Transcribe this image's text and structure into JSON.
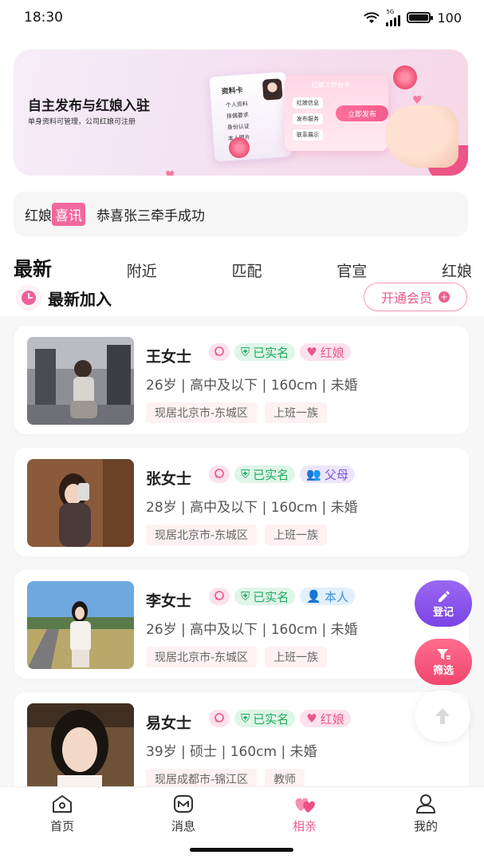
{
  "status_bar": {
    "time": "18:30",
    "network": "5G",
    "battery": "100"
  },
  "banner": {
    "title": "自主发布与红娘入驻",
    "subtitle": "单身资料可管理，公司红娘可注册",
    "card_left_title": "资料卡",
    "card_left_items": [
      "个人资料",
      "择偶要求",
      "身份认证",
      "本人照片"
    ],
    "card_right_title": "红娘工作台卡",
    "card_right_items": [
      "红娘信息",
      "发布服务",
      "联系展示"
    ],
    "publish_label": "立即发布"
  },
  "news": {
    "prefix": "红娘",
    "tag": "喜讯",
    "text": "恭喜张三牵手成功"
  },
  "tabs": [
    {
      "label": "最新",
      "active": true
    },
    {
      "label": "附近",
      "active": false
    },
    {
      "label": "匹配",
      "active": false
    },
    {
      "label": "官宣",
      "active": false
    },
    {
      "label": "红娘",
      "active": false
    }
  ],
  "section": {
    "title": "最新加入",
    "vip_label": "开通会员"
  },
  "profiles": [
    {
      "name": "王女士",
      "verified": "已实名",
      "role": "红娘",
      "role_color": "pink",
      "info": "26岁 | 高中及以下 | 160cm | 未婚",
      "location": "现居北京市-东城区",
      "job": "上班一族"
    },
    {
      "name": "张女士",
      "verified": "已实名",
      "role": "父母",
      "role_color": "purple",
      "info": "28岁 | 高中及以下 | 160cm | 未婚",
      "location": "现居北京市-东城区",
      "job": "上班一族"
    },
    {
      "name": "李女士",
      "verified": "已实名",
      "role": "本人",
      "role_color": "blue",
      "info": "26岁 | 高中及以下 | 160cm | 未婚",
      "location": "现居北京市-东城区",
      "job": "上班一族"
    },
    {
      "name": "易女士",
      "verified": "已实名",
      "role": "红娘",
      "role_color": "pink",
      "info": "39岁 | 硕士 | 160cm | 未婚",
      "location": "现居成都市-锦江区",
      "job": "教师"
    }
  ],
  "fabs": {
    "register": "登记",
    "filter": "筛选"
  },
  "bottom_nav": [
    {
      "label": "首页",
      "icon": "home-icon"
    },
    {
      "label": "消息",
      "icon": "message-icon"
    },
    {
      "label": "相亲",
      "icon": "hearts-icon",
      "active": true
    },
    {
      "label": "我的",
      "icon": "user-icon"
    }
  ],
  "colors": {
    "accent": "#ef6096",
    "verified": "#1faa5f",
    "purple": "#7b44e6"
  }
}
